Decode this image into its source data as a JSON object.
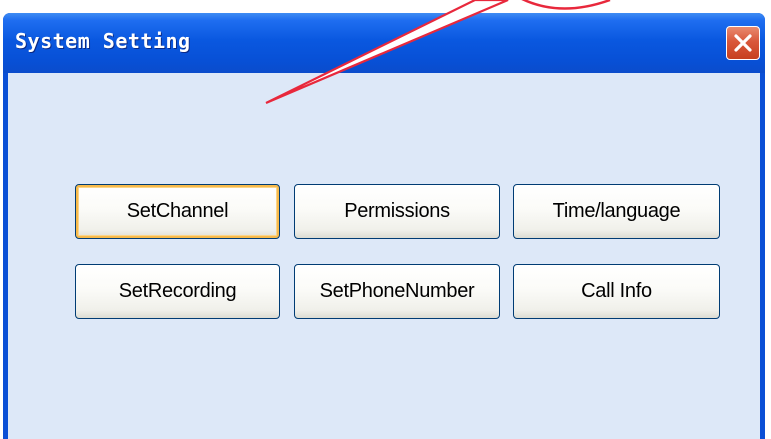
{
  "window": {
    "title": "System Setting",
    "close_icon": "close-icon",
    "accent_color": "#0a4fd6",
    "client_bg": "#dde8f8"
  },
  "buttons": [
    {
      "label": "SetChannel",
      "focused": true
    },
    {
      "label": "Permissions",
      "focused": false
    },
    {
      "label": "Time/language",
      "focused": false
    },
    {
      "label": "SetRecording",
      "focused": false
    },
    {
      "label": "SetPhoneNumber",
      "focused": false
    },
    {
      "label": "Call Info",
      "focused": false
    }
  ],
  "annotation": {
    "type": "callout-arrow",
    "color": "#e8283c"
  }
}
